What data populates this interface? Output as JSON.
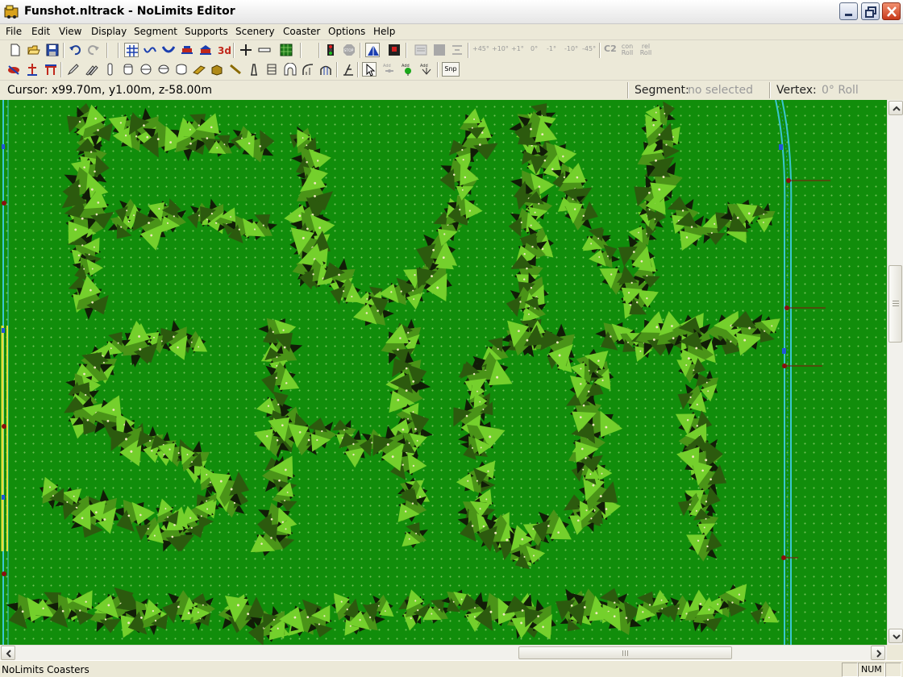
{
  "window": {
    "title": "Funshot.nltrack - NoLimits Editor"
  },
  "menu": [
    "File",
    "Edit",
    "View",
    "Display",
    "Segment",
    "Supports",
    "Scenery",
    "Coaster",
    "Options",
    "Help"
  ],
  "toolbar1": {
    "icons": [
      "new-file-icon",
      "open-folder-icon",
      "save-disk-icon",
      "undo-icon",
      "redo-icon",
      "grid-icon",
      "wave-track-icon",
      "dip-track-icon",
      "coaster-train-icon",
      "station-icon",
      "view-3d-icon",
      "add-segment-icon",
      "remove-segment-icon",
      "terrain-icon",
      "traffic-light-icon",
      "stop-icon",
      "pyramid-icon",
      "camera-icon",
      "grey-box-icon",
      "dark-grey-box-icon",
      "align-icon"
    ],
    "view3d_label": "3d",
    "stop_label": "STOP",
    "angle_buttons": [
      "+45°",
      "+10°",
      "+1°",
      "0°",
      "-1°",
      "-10°",
      "-45°"
    ],
    "c2_label": "C2",
    "con_roll_label": "con Roll",
    "rel_roll_label": "rel Roll"
  },
  "toolbar2": {
    "icons": [
      "support-tool-icon",
      "support-footer-icon",
      "support-beam-icon",
      "pencil-icon",
      "double-pencil-icon",
      "pillar-icon",
      "tube-icon",
      "ring-icon",
      "barrel-icon",
      "plank-icon",
      "box-icon",
      "rod-icon",
      "tower-icon",
      "catwalk-icon",
      "tunnel-icon",
      "curve-tool-icon",
      "arc-tool-icon",
      "ramp-tool-icon",
      "pointer-icon",
      "add-node-icon",
      "add-green-node-icon",
      "add-connector-icon"
    ],
    "add_label": "Add",
    "snap_label": "Snp"
  },
  "info": {
    "cursor": "Cursor: x99.70m, y1.00m, z-58.00m",
    "segment_label": "Segment:",
    "segment_value": "no selected",
    "vertex_label": "Vertex:",
    "vertex_value": "0° Roll"
  },
  "canvas": {
    "scenery_text_line1": "FUN-",
    "scenery_text_line2": "SHOT",
    "background_color": "#118d0b",
    "tree_colors": [
      "#0f1a06",
      "#2e5a10",
      "#4f9a1c",
      "#6ecf2a",
      "#8fe23a"
    ],
    "track_color": "#39c6d0"
  },
  "status": {
    "left_text": "NoLimits Coasters",
    "num_indicator": "NUM"
  }
}
